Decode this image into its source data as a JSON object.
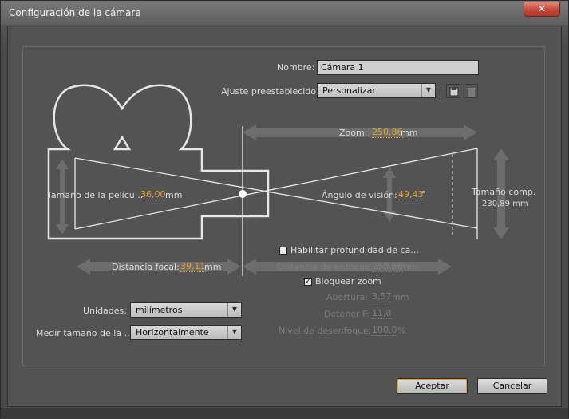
{
  "window": {
    "title": "Configuración de la cámara",
    "close": "✕"
  },
  "nombre": {
    "label": "Nombre:",
    "value": "Cámara 1"
  },
  "preset": {
    "label": "Ajuste preestablecido:",
    "value": "Personalizar"
  },
  "zoom": {
    "label": "Zoom:",
    "value": "250,86",
    "unit": "mm"
  },
  "film": {
    "label": "Tamaño de la pelícu...",
    "value": "36,00",
    "unit": "mm"
  },
  "angle": {
    "label": "Ángulo de visión:",
    "value": "49,43",
    "unit": "°"
  },
  "comp": {
    "label": "Tamaño comp.",
    "value": "230,89 mm"
  },
  "focal": {
    "label": "Distancia focal:",
    "value": "39,11",
    "unit": "mm"
  },
  "dof": {
    "label": "Habilitar profundidad de ca...",
    "checked": false
  },
  "focus": {
    "label": "Distancia de enfoque:",
    "value": "250,86",
    "unit": "mm"
  },
  "lockzoom": {
    "label": "Bloquear zoom",
    "checked": true,
    "mark": "✓"
  },
  "aperture": {
    "label": "Abertura:",
    "value": "3,57",
    "unit": "mm"
  },
  "fstop": {
    "label": "Detener F:",
    "value": "11,0"
  },
  "blur": {
    "label": "Nivel de desenfoque:",
    "value": "100,0",
    "unit": "%"
  },
  "units": {
    "label": "Unidades:",
    "value": "milímetros"
  },
  "measure": {
    "label": "Medir tamaño de la ...",
    "value": "Horizontalmente"
  },
  "buttons": {
    "ok": "Aceptar",
    "cancel": "Cancelar"
  },
  "icons": {
    "dropdown": "▼"
  },
  "colors": {
    "accent": "#e1a531",
    "diagram": "#e6e6e6",
    "arrow": "#8a8a8a"
  }
}
